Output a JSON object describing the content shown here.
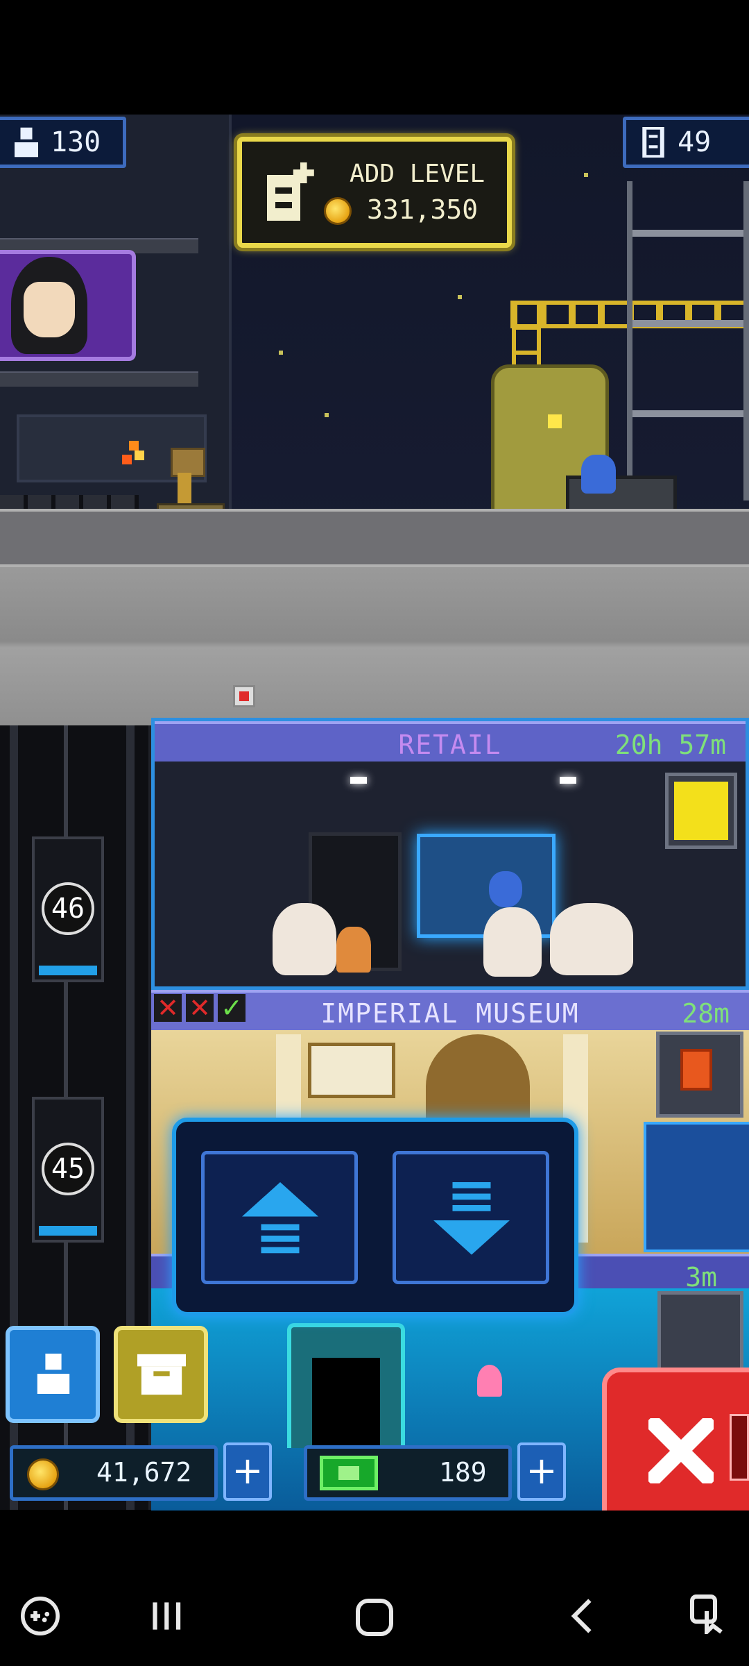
{
  "hud": {
    "population": "130",
    "floors": "49",
    "add_level_label": "ADD LEVEL",
    "add_level_cost": "331,350",
    "coins": "41,672",
    "bux": "189"
  },
  "floors": [
    {
      "name": "RETAIL",
      "timer": "20h 57m",
      "elevator_number": "46"
    },
    {
      "name": "IMPERIAL MUSEUM",
      "timer": "28m",
      "elevator_number": "45"
    },
    {
      "timer": "3m"
    }
  ],
  "colors": {
    "accent_gold": "#e9d84a",
    "accent_blue": "#2aa4ff",
    "floor_header": "#6b6fd0",
    "close_red": "#e02a2a"
  },
  "icons": [
    "person-icon",
    "floors-icon",
    "add-level-icon",
    "coin-icon",
    "bux-icon",
    "plus-icon",
    "elevator-icon",
    "arrow-up-icon",
    "arrow-down-icon",
    "close-icon",
    "home-nav-icon",
    "back-nav-icon",
    "recents-nav-icon",
    "game-tools-icon"
  ]
}
